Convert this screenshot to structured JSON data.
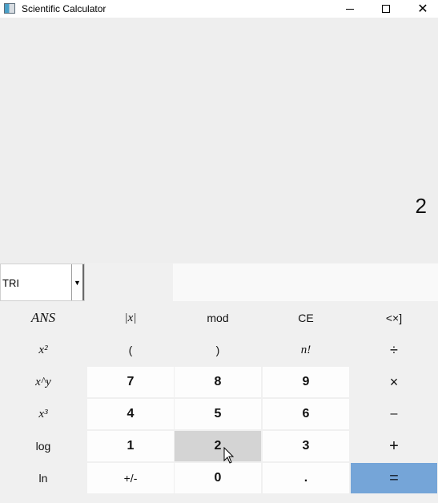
{
  "window": {
    "title": "Scientific Calculator",
    "controls": {
      "minimize": "—",
      "maximize": "☐",
      "close": "✕"
    }
  },
  "display": {
    "value": "2"
  },
  "mode": {
    "selected": "TRI"
  },
  "buttons": {
    "row1": [
      "ANS",
      "|x|",
      "mod",
      "CE",
      "<×]"
    ],
    "row2": [
      "x²",
      "(",
      ")",
      "n!",
      "÷"
    ],
    "row3": [
      "x^y",
      "7",
      "8",
      "9",
      "×"
    ],
    "row4": [
      "x³",
      "4",
      "5",
      "6",
      "–"
    ],
    "row5": [
      "log",
      "1",
      "2",
      "3",
      "+"
    ],
    "row6": [
      "ln",
      "+/-",
      "0",
      ".",
      "="
    ]
  },
  "colors": {
    "equals_button": "#75a5d8",
    "hover_button": "#d4d4d4",
    "digit_button": "#fdfdfd",
    "function_button": "#f0f0f0"
  }
}
